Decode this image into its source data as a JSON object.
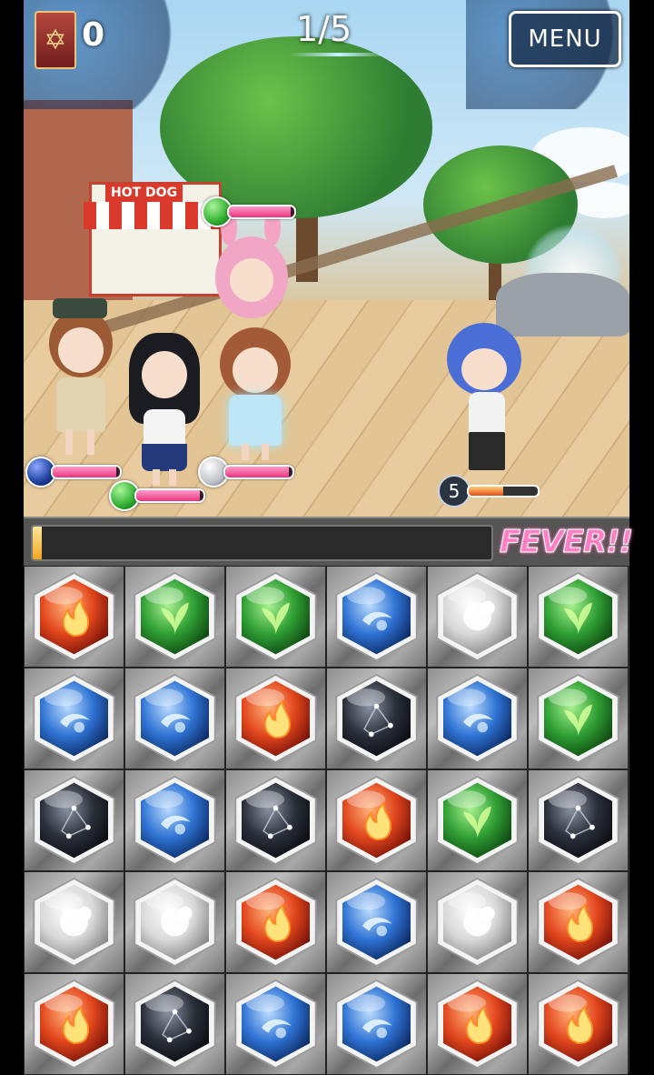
{
  "hud": {
    "item_count": "0",
    "wave_text": "1/5",
    "menu_label": "MENU"
  },
  "scene": {
    "stand_sign": "HOT DOG",
    "party": [
      {
        "name_icon": "green-orb",
        "orb_color": "#2fae2f",
        "hp": 0.95
      },
      {
        "name_icon": "blue-orb",
        "orb_color": "#1c3f9a",
        "hp": 0.95
      },
      {
        "name_icon": "green-orb",
        "orb_color": "#2fae2f",
        "hp": 0.95
      },
      {
        "name_icon": "silver-orb",
        "orb_color": "#bfc3c8",
        "hp": 0.95
      }
    ],
    "enemy": {
      "cooldown": "5",
      "hp": 0.5
    }
  },
  "fever": {
    "label": "FEVER!!",
    "fill": 0.02
  },
  "colors": {
    "fire": "#e2461d",
    "wood": "#2f9f34",
    "water": "#2f73d4",
    "light": "#e7e7e7",
    "dark": "#2a2f3a"
  },
  "board": {
    "rows": [
      [
        "fire",
        "wood",
        "wood",
        "water",
        "light",
        "wood"
      ],
      [
        "water",
        "water",
        "fire",
        "dark",
        "water",
        "wood"
      ],
      [
        "dark",
        "water",
        "dark",
        "fire",
        "wood",
        "dark"
      ],
      [
        "light",
        "light",
        "fire",
        "water",
        "light",
        "fire"
      ],
      [
        "fire",
        "dark",
        "water",
        "water",
        "fire",
        "fire"
      ]
    ]
  }
}
